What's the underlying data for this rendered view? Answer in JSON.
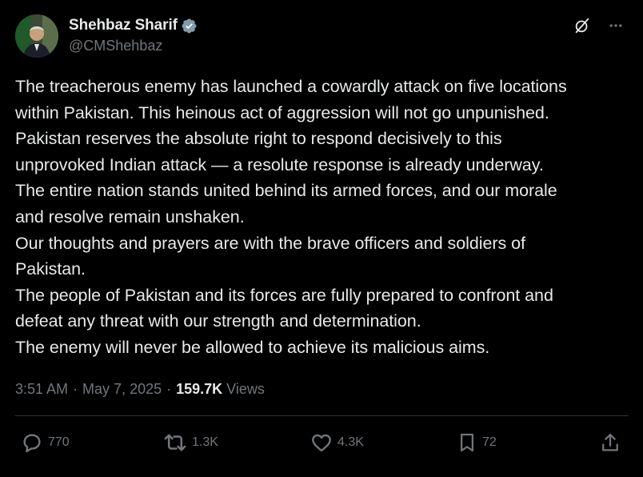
{
  "author": {
    "display_name": "Shehbaz Sharif",
    "handle": "@CMShehbaz",
    "verified_icon": "verified-badge-icon"
  },
  "post": {
    "lines": [
      "The treacherous enemy has launched a cowardly attack on five locations",
      "within Pakistan. This heinous act of aggression will not go unpunished.",
      "Pakistan reserves the absolute right to respond decisively to this",
      "unprovoked Indian attack — a resolute response is already underway.",
      "The entire nation stands united behind its armed forces, and our morale",
      "and resolve remain unshaken.",
      "Our thoughts and prayers are with the brave officers and soldiers of",
      "Pakistan.",
      "The people of Pakistan and its forces are fully prepared to confront and",
      "defeat any threat with our strength and determination.",
      "The enemy will never be allowed to achieve its malicious aims."
    ]
  },
  "meta": {
    "time": "3:51 AM",
    "separator": "·",
    "date": "May 7, 2025",
    "separator2": "·",
    "views_count": "159.7K",
    "views_label": "Views"
  },
  "actions": {
    "replies": "770",
    "reposts": "1.3K",
    "likes": "4.3K",
    "bookmarks": "72"
  },
  "colors": {
    "background": "#000000",
    "text": "#e7e9ea",
    "secondary": "#71767b",
    "verified": "#829aab",
    "divider": "#2f3336"
  }
}
